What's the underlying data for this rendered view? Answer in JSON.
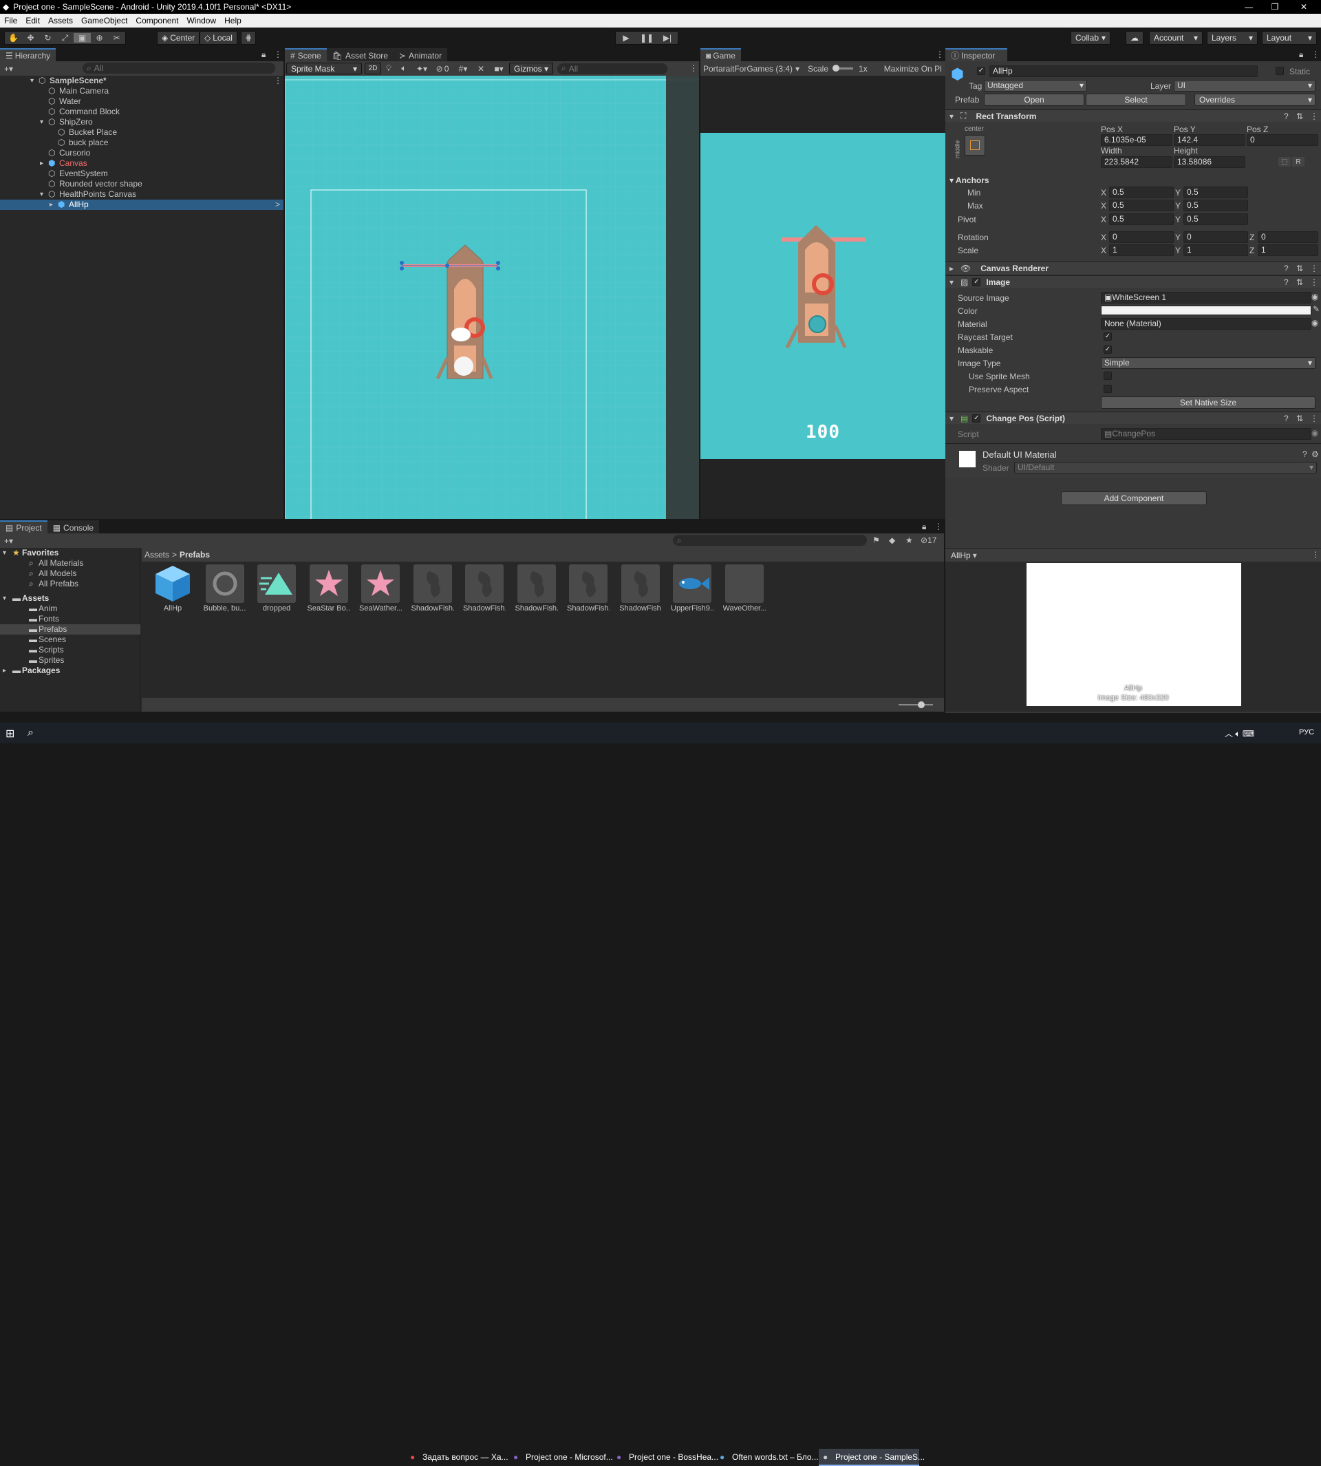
{
  "window": {
    "title": "Project one - SampleScene - Android - Unity 2019.4.10f1 Personal* <DX11>"
  },
  "menu": [
    "File",
    "Edit",
    "Assets",
    "GameObject",
    "Component",
    "Window",
    "Help"
  ],
  "toolbar": {
    "center": "Center",
    "local": "Local",
    "collab": "Collab",
    "account": "Account",
    "layers": "Layers",
    "layout": "Layout"
  },
  "hierarchy": {
    "tab": "Hierarchy",
    "search_placeholder": "All",
    "items": [
      {
        "label": "SampleScene*",
        "depth": 0,
        "bold": true
      },
      {
        "label": "Main Camera",
        "depth": 1
      },
      {
        "label": "Water",
        "depth": 1
      },
      {
        "label": "Command Block",
        "depth": 1
      },
      {
        "label": "ShipZero",
        "depth": 1
      },
      {
        "label": "Bucket Place",
        "depth": 2
      },
      {
        "label": "buck place",
        "depth": 2
      },
      {
        "label": "Cursorio",
        "depth": 1
      },
      {
        "label": "Canvas",
        "depth": 1,
        "color": "#f16b6b"
      },
      {
        "label": "EventSystem",
        "depth": 1
      },
      {
        "label": "Rounded vector shape",
        "depth": 1
      },
      {
        "label": "HealthPoints Canvas",
        "depth": 1
      },
      {
        "label": "AllHp",
        "depth": 2,
        "selected": true
      }
    ]
  },
  "scene": {
    "tabs": [
      "Scene",
      "Asset Store",
      "Animator"
    ],
    "mode": "Sprite Mask",
    "mode2d": "2D",
    "hidden_count": "0",
    "gizmos": "Gizmos",
    "search_placeholder": "All"
  },
  "game": {
    "tab": "Game",
    "aspect": "PortaraitForGames (3:4)",
    "scale_label": "Scale",
    "scale_value": "1x",
    "maximize": "Maximize On Pl",
    "hp_text": "100"
  },
  "inspector": {
    "tab": "Inspector",
    "object_name": "AllHp",
    "static": "Static",
    "tag_label": "Tag",
    "tag": "Untagged",
    "layer_label": "Layer",
    "layer": "UI",
    "prefab_label": "Prefab",
    "open": "Open",
    "select": "Select",
    "overrides": "Overrides",
    "rect": {
      "title": "Rect Transform",
      "anchor_label": "center",
      "side_label": "middle",
      "posx_label": "Pos X",
      "posy_label": "Pos Y",
      "posz_label": "Pos Z",
      "posx": "6.1035e-05",
      "posy": "142.4",
      "posz": "0",
      "width_label": "Width",
      "height_label": "Height",
      "width": "223.5842",
      "height": "13.58086",
      "anchors": "Anchors",
      "min": "Min",
      "max": "Max",
      "min_x": "0.5",
      "min_y": "0.5",
      "max_x": "0.5",
      "max_y": "0.5",
      "pivot": "Pivot",
      "pivot_x": "0.5",
      "pivot_y": "0.5",
      "rotation": "Rotation",
      "rot_x": "0",
      "rot_y": "0",
      "rot_z": "0",
      "scale": "Scale",
      "scale_x": "1",
      "scale_y": "1",
      "scale_z": "1"
    },
    "canvas_renderer": "Canvas Renderer",
    "image": {
      "title": "Image",
      "source_label": "Source Image",
      "source": "WhiteScreen 1",
      "color_label": "Color",
      "material_label": "Material",
      "material": "None (Material)",
      "raycast": "Raycast Target",
      "maskable": "Maskable",
      "type_label": "Image Type",
      "type": "Simple",
      "use_sprite_mesh": "Use Sprite Mesh",
      "preserve": "Preserve Aspect",
      "native": "Set Native Size"
    },
    "changepos": {
      "title": "Change Pos (Script)",
      "script_label": "Script",
      "script": "ChangePos"
    },
    "material": {
      "title": "Default UI Material",
      "shader_label": "Shader",
      "shader": "UI/Default"
    },
    "add_component": "Add Component",
    "preview": {
      "name": "AllHp",
      "line1": "AllHp",
      "line2": "Image Size: 480x320"
    }
  },
  "project": {
    "tabs": [
      "Project",
      "Console"
    ],
    "tree": [
      {
        "label": "Favorites",
        "bold": true,
        "depth": 0
      },
      {
        "label": "All Materials",
        "depth": 1
      },
      {
        "label": "All Models",
        "depth": 1
      },
      {
        "label": "All Prefabs",
        "depth": 1
      },
      {
        "label": "Assets",
        "bold": true,
        "depth": 0
      },
      {
        "label": "Anim",
        "depth": 1
      },
      {
        "label": "Fonts",
        "depth": 1
      },
      {
        "label": "Prefabs",
        "depth": 1,
        "selected": true
      },
      {
        "label": "Scenes",
        "depth": 1
      },
      {
        "label": "Scripts",
        "depth": 1
      },
      {
        "label": "Sprites",
        "depth": 1
      },
      {
        "label": "Packages",
        "bold": true,
        "depth": 0
      }
    ],
    "breadcrumb": [
      "Assets",
      "Prefabs"
    ],
    "hidden_count": "17",
    "assets": [
      {
        "label": "AllHp",
        "kind": "cube"
      },
      {
        "label": "Bubble, bu...",
        "kind": "ring"
      },
      {
        "label": "dropped",
        "kind": "tri"
      },
      {
        "label": "SeaStar Bo...",
        "kind": "star"
      },
      {
        "label": "SeaWather...",
        "kind": "star"
      },
      {
        "label": "ShadowFish...",
        "kind": "shadow"
      },
      {
        "label": "ShadowFish...",
        "kind": "shadow"
      },
      {
        "label": "ShadowFish...",
        "kind": "shadow"
      },
      {
        "label": "ShadowFish...",
        "kind": "shadow"
      },
      {
        "label": "ShadowFish",
        "kind": "shadow"
      },
      {
        "label": "UpperFish9...",
        "kind": "fish"
      },
      {
        "label": "WaveOther...",
        "kind": "blank"
      }
    ]
  },
  "taskbar": {
    "items": [
      {
        "label": "Задать вопрос — Ха...",
        "color": "#e8453c"
      },
      {
        "label": "Project one - Microsof...",
        "color": "#8661c5"
      },
      {
        "label": "Project one - BossHea...",
        "color": "#8661c5"
      },
      {
        "label": "Often words.txt – Бло...",
        "color": "#5ea6d8"
      },
      {
        "label": "Project one - SampleS...",
        "color": "#cccccc"
      }
    ],
    "lang": "РУС"
  }
}
